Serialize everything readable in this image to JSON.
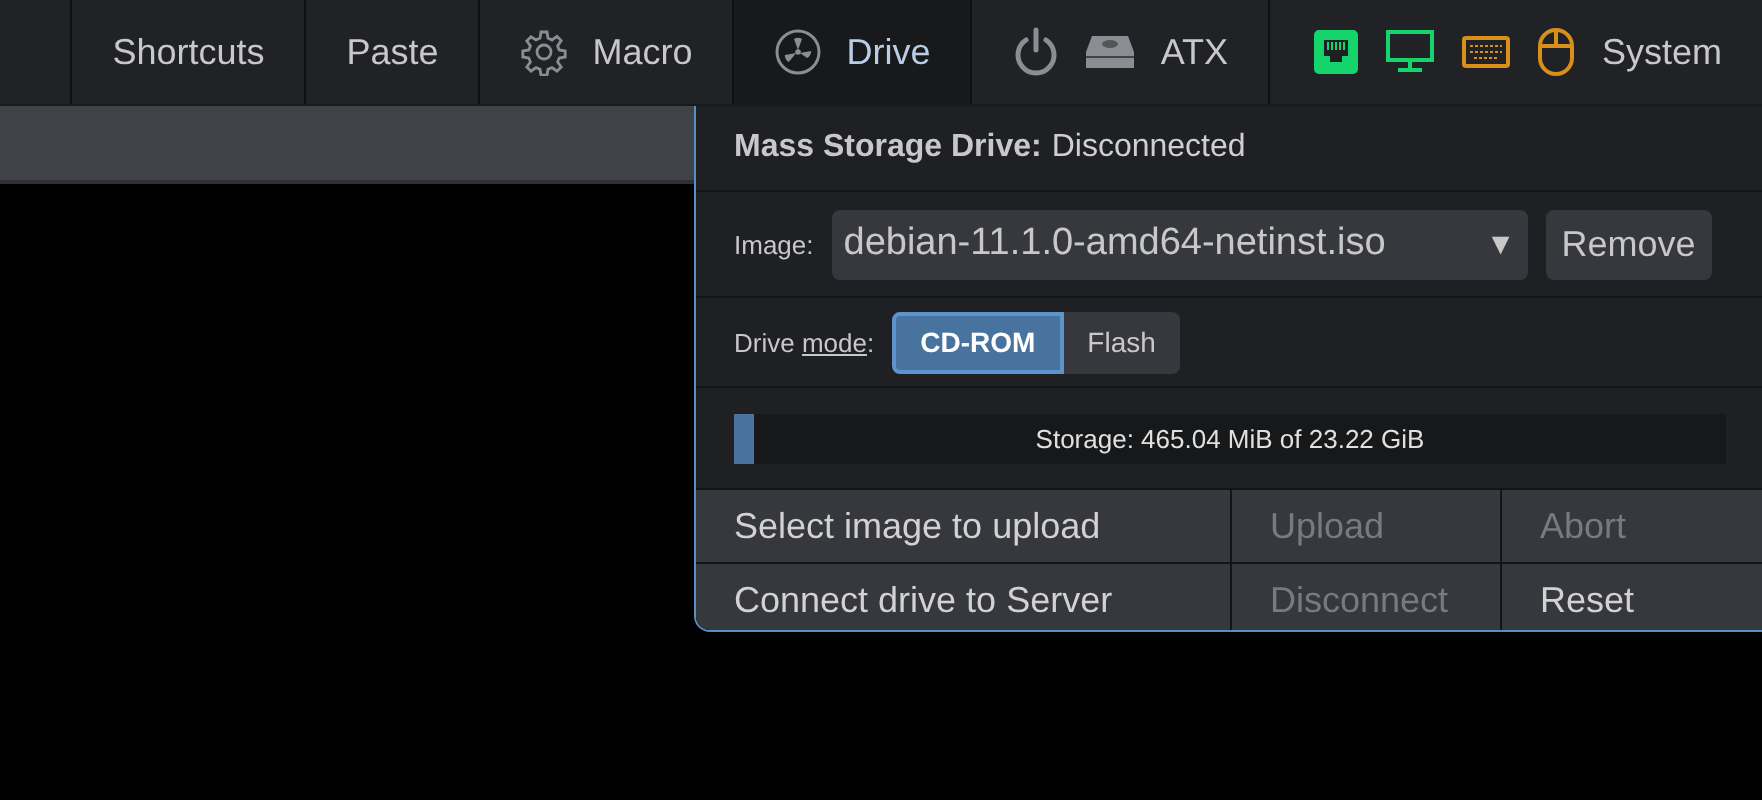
{
  "menu": [
    {
      "label": "Shortcuts",
      "selected": false
    },
    {
      "label": "Paste",
      "selected": false
    },
    {
      "label": "Macro",
      "selected": false
    },
    {
      "label": "Drive",
      "selected": true
    },
    {
      "label": "ATX",
      "selected": false
    }
  ],
  "system": {
    "label": "System",
    "indicators": [
      {
        "kind": "network",
        "color": "#16d46c"
      },
      {
        "kind": "monitor",
        "color": "#16d46c"
      },
      {
        "kind": "keyboard",
        "color": "#d8901a"
      },
      {
        "kind": "mouse",
        "color": "#d8901a"
      }
    ]
  },
  "drive": {
    "title": "Mass Storage Drive:",
    "status": "Disconnected",
    "image_label": "Image:",
    "image_value": "debian-11.1.0-amd64-netinst.iso",
    "arrow": "▼",
    "remove": "Remove",
    "mode_label": [
      {
        "text": "Drive ",
        "underline": false
      },
      {
        "text": "mode",
        "underline": true
      },
      {
        "text": ":",
        "underline": false
      }
    ],
    "modes": [
      {
        "label": "CD-ROM",
        "selected": true
      },
      {
        "label": "Flash",
        "selected": false
      }
    ],
    "storage": {
      "text": "Storage: 465.04 MiB of 23.22 GiB",
      "level": 0.02
    },
    "actions": [
      {
        "label": "Select image to upload",
        "disabled": false
      },
      {
        "label": "Upload",
        "disabled": true
      },
      {
        "label": "Abort",
        "disabled": true
      },
      {
        "label": "Connect drive to Server",
        "disabled": false
      },
      {
        "label": "Disconnect",
        "disabled": true
      },
      {
        "label": "Reset",
        "disabled": false
      }
    ]
  }
}
